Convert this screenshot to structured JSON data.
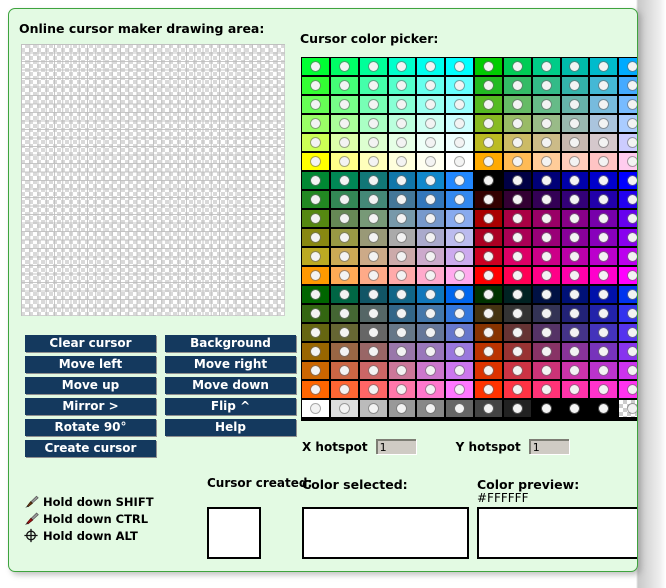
{
  "page": {
    "panel_bg": "#e3fae3",
    "panel_border": "#3ea33e"
  },
  "drawing": {
    "title": "Online cursor maker drawing area:",
    "grid_cols": 32,
    "grid_rows": 32
  },
  "buttons": {
    "accent": "#14395e",
    "rows": [
      {
        "left": "Clear cursor",
        "right": "Background"
      },
      {
        "left": "Move left",
        "right": "Move right"
      },
      {
        "left": "Move up",
        "right": "Move down"
      },
      {
        "left": "Mirror >",
        "right": "Flip ^"
      },
      {
        "left": "Rotate 90°",
        "right": "Help"
      },
      {
        "left": "Create cursor",
        "right": ""
      }
    ]
  },
  "hints": [
    {
      "icon": "paintbrush-icon",
      "label": "Hold down SHIFT"
    },
    {
      "icon": "eyedropper-icon",
      "label": "Hold down CTRL"
    },
    {
      "icon": "crosshair-icon",
      "label": "Hold down ALT"
    }
  ],
  "cursor_created": {
    "label": "Cursor created:"
  },
  "picker": {
    "title": "Cursor color picker:",
    "columns": 12,
    "rows": 19,
    "swatch_rows": [
      [
        "#00ff33",
        "#00ff66",
        "#00ff99",
        "#00ffcc",
        "#00ffee",
        "#00ffff",
        "#00cc00",
        "#00cc55",
        "#00cc88",
        "#00bbaa",
        "#00bbcc",
        "#00aaff"
      ],
      [
        "#33ff33",
        "#44ff77",
        "#44ffaa",
        "#55ffcc",
        "#66ffee",
        "#66ffff",
        "#22bb22",
        "#33bb66",
        "#33bb88",
        "#33b3aa",
        "#44b8d5",
        "#44aaff"
      ],
      [
        "#66ff55",
        "#77ff88",
        "#77ffb5",
        "#88ffd5",
        "#99fff0",
        "#99ffff",
        "#55bb22",
        "#66bb66",
        "#66bb88",
        "#66b3aa",
        "#77bbdd",
        "#77bbff"
      ],
      [
        "#99ff66",
        "#aaff99",
        "#aaffc4",
        "#bbffdd",
        "#ccfff2",
        "#ccffff",
        "#88bb22",
        "#99bb66",
        "#99bb88",
        "#99b8b0",
        "#aac4dd",
        "#aaccff"
      ],
      [
        "#ccff55",
        "#ddffaa",
        "#ddffd0",
        "#e6ffe6",
        "#eefff7",
        "#eeffff",
        "#bbbb22",
        "#ccbb66",
        "#ccbb88",
        "#c7b8b0",
        "#d5c8cc",
        "#ccccff"
      ],
      [
        "#ffff00",
        "#ffff88",
        "#ffffbb",
        "#ffffdd",
        "#fffff0",
        "#ffffff",
        "#ffaa00",
        "#ffbb55",
        "#ffcc99",
        "#ffccbb",
        "#ffc4c4",
        "#ffccee"
      ],
      [
        "#008833",
        "#008855",
        "#117777",
        "#1177aa",
        "#1188cc",
        "#2288ff",
        "#000000",
        "#000044",
        "#000077",
        "#0000aa",
        "#0000cc",
        "#0000ff"
      ],
      [
        "#228822",
        "#338855",
        "#448877",
        "#447799",
        "#3377bb",
        "#3388ee",
        "#330000",
        "#330033",
        "#330055",
        "#330077",
        "#2200aa",
        "#2200ee"
      ],
      [
        "#558811",
        "#668855",
        "#779977",
        "#7799aa",
        "#7799cc",
        "#88aaee",
        "#aa0000",
        "#aa0044",
        "#990066",
        "#880088",
        "#7700aa",
        "#6600ee"
      ],
      [
        "#888811",
        "#999944",
        "#999977",
        "#aaaaaa",
        "#aaaacc",
        "#bbbbee",
        "#aa0022",
        "#aa0055",
        "#990077",
        "#880099",
        "#8800bb",
        "#8800ee"
      ],
      [
        "#bbaa22",
        "#ccaa55",
        "#ccaa88",
        "#ccaaaa",
        "#ccaacc",
        "#ccaaee",
        "#cc0022",
        "#dd0066",
        "#cc0088",
        "#bb00aa",
        "#bb00cc",
        "#bb00ee"
      ],
      [
        "#ff9900",
        "#ffaa55",
        "#ffaa88",
        "#ffaaaa",
        "#ffaacc",
        "#ffaaee",
        "#ff0000",
        "#ff0055",
        "#ff0088",
        "#ff00aa",
        "#ff00cc",
        "#ff00ff"
      ],
      [
        "#006600",
        "#006644",
        "#115566",
        "#116688",
        "#1177bb",
        "#0066ee",
        "#003300",
        "#002222",
        "#001144",
        "#001177",
        "#0011aa",
        "#0033ee"
      ],
      [
        "#336611",
        "#446633",
        "#556666",
        "#336688",
        "#4477aa",
        "#3377dd",
        "#443311",
        "#333333",
        "#333355",
        "#222277",
        "#2222aa",
        "#3333ee"
      ],
      [
        "#666611",
        "#666633",
        "#666666",
        "#667788",
        "#667799",
        "#6677cc",
        "#883300",
        "#663333",
        "#553366",
        "#443388",
        "#4433bb",
        "#5533ee"
      ],
      [
        "#996600",
        "#996644",
        "#996666",
        "#9977aa",
        "#9977bb",
        "#9977dd",
        "#bb3300",
        "#993333",
        "#883366",
        "#883399",
        "#7733bb",
        "#8833ee"
      ],
      [
        "#cc6600",
        "#cc6644",
        "#cc6666",
        "#cc7799",
        "#cc77cc",
        "#cc77ee",
        "#dd3300",
        "#cc3344",
        "#cc3377",
        "#cc33aa",
        "#bb33cc",
        "#cc33ee"
      ],
      [
        "#ff6600",
        "#ff6633",
        "#ff6666",
        "#ff77aa",
        "#ff77cc",
        "#ff77ff",
        "#ff3300",
        "#ff3344",
        "#ff3377",
        "#ff33aa",
        "#ff33cc",
        "#ff33ee"
      ],
      [
        "#ffffff",
        "#dddddd",
        "#bbbbbb",
        "#999999",
        "#888888",
        "#666666",
        "#444444",
        "#222222",
        "#000000",
        "#000000",
        "#000000",
        "transparent"
      ]
    ]
  },
  "hotspot": {
    "x_label": "X hotspot",
    "x_value": "1",
    "y_label": "Y hotspot",
    "y_value": "1"
  },
  "color_selected": {
    "label": "Color selected:",
    "value": "#FFFFFF"
  },
  "color_preview": {
    "label": "Color preview:",
    "hex": "#FFFFFF",
    "value": "#FFFFFF"
  }
}
